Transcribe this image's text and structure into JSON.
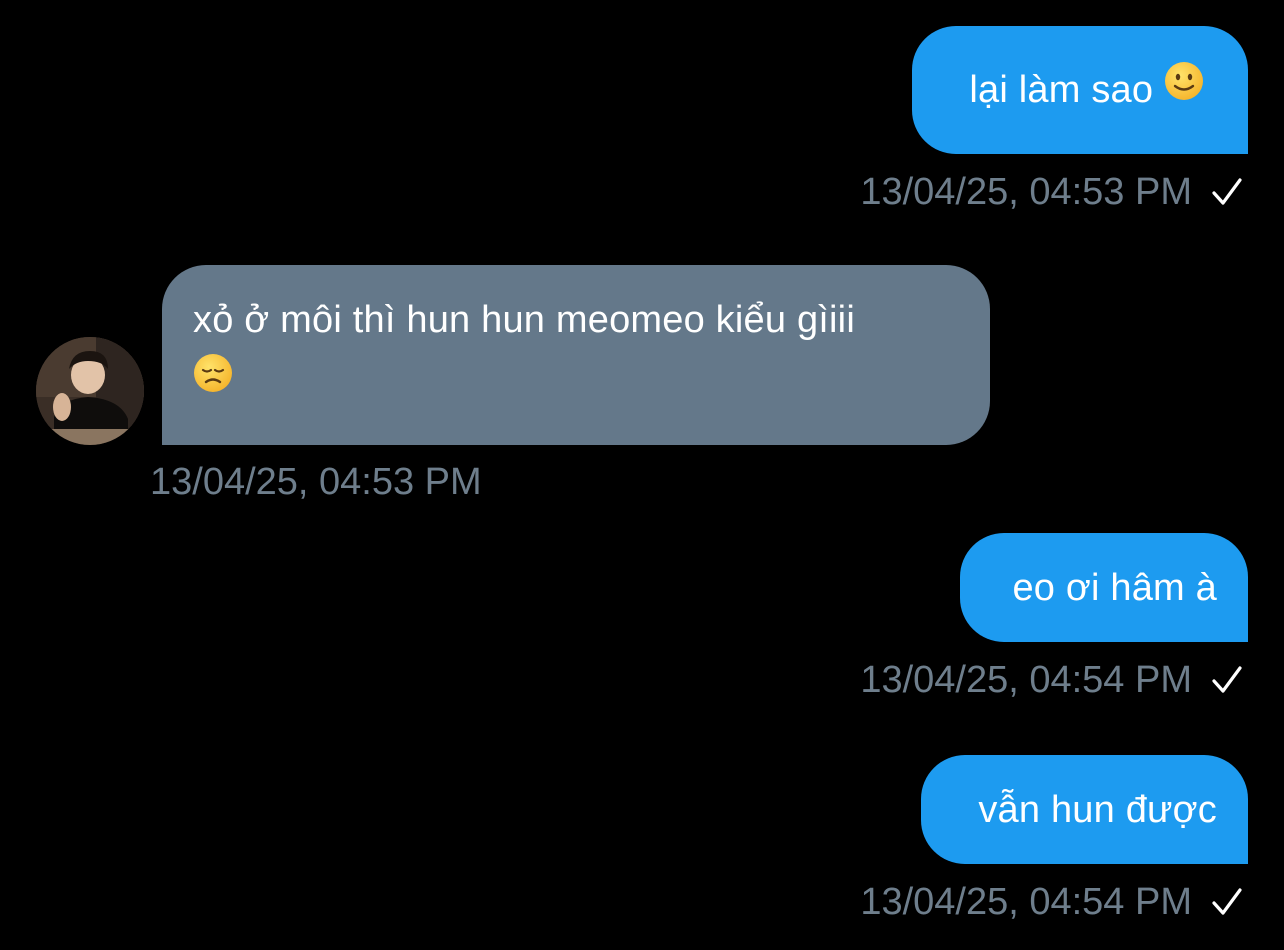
{
  "colors": {
    "background": "#000000",
    "outgoing_bubble": "#1d9bf0",
    "incoming_bubble": "#64788a",
    "timestamp_text": "#6e7e8c",
    "message_text": "#ffffff"
  },
  "messages": [
    {
      "direction": "outgoing",
      "text": "lại làm sao",
      "emoji": "slightly-smiling-face-icon",
      "timestamp": "13/04/25, 04:53 PM",
      "status_icon": "checkmark-icon"
    },
    {
      "direction": "incoming",
      "text": "xỏ ở môi thì hun hun meomeo kiểu gìiii",
      "emoji": "disappointed-face-icon",
      "timestamp": "13/04/25, 04:53 PM",
      "avatar": "sender-avatar"
    },
    {
      "direction": "outgoing",
      "text": "eo ơi hâm à",
      "timestamp": "13/04/25, 04:54 PM",
      "status_icon": "checkmark-icon"
    },
    {
      "direction": "outgoing",
      "text": "vẫn hun được",
      "timestamp": "13/04/25, 04:54 PM",
      "status_icon": "checkmark-icon"
    }
  ]
}
